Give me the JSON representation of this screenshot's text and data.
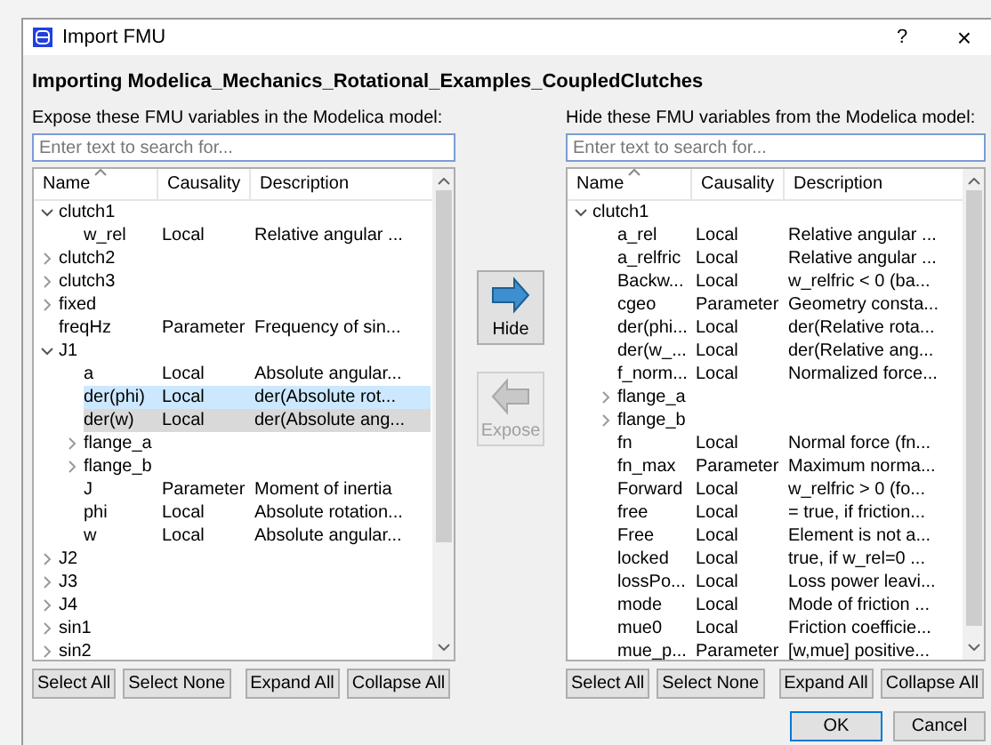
{
  "window": {
    "title": "Import FMU",
    "help": "?",
    "close": "×"
  },
  "heading": "Importing Modelica_Mechanics_Rotational_Examples_CoupledClutches",
  "panels": [
    {
      "label": "Expose these FMU variables in the Modelica model:",
      "search": {
        "placeholder": "Enter text to search for..."
      },
      "columns": [
        "Name",
        "Causality",
        "Description"
      ],
      "tree": [
        {
          "name": "clutch1",
          "expanded": true,
          "selected": false,
          "hovered": false,
          "children": [
            {
              "name": "w_rel",
              "causality": "Local",
              "description": "Relative angular ...",
              "selected": false,
              "hovered": false
            }
          ]
        },
        {
          "name": "clutch2",
          "expanded": false,
          "selected": false,
          "hovered": false
        },
        {
          "name": "clutch3",
          "expanded": false,
          "selected": false,
          "hovered": false
        },
        {
          "name": "fixed",
          "expanded": false,
          "selected": false,
          "hovered": false
        },
        {
          "name": "freqHz",
          "causality": "Parameter",
          "description": "Frequency of sin...",
          "selected": false,
          "hovered": false
        },
        {
          "name": "J1",
          "expanded": true,
          "selected": false,
          "hovered": false,
          "children": [
            {
              "name": "a",
              "causality": "Local",
              "description": "Absolute angular...",
              "selected": false,
              "hovered": false
            },
            {
              "name": "der(phi)",
              "causality": "Local",
              "description": "der(Absolute rot...",
              "selected": true,
              "hovered": false
            },
            {
              "name": "der(w)",
              "causality": "Local",
              "description": "der(Absolute ang...",
              "selected": false,
              "hovered": true
            },
            {
              "name": "flange_a",
              "expanded": false,
              "selected": false,
              "hovered": false
            },
            {
              "name": "flange_b",
              "expanded": false,
              "selected": false,
              "hovered": false
            },
            {
              "name": "J",
              "causality": "Parameter",
              "description": "Moment of inertia",
              "selected": false,
              "hovered": false
            },
            {
              "name": "phi",
              "causality": "Local",
              "description": "Absolute rotation...",
              "selected": false,
              "hovered": false
            },
            {
              "name": "w",
              "causality": "Local",
              "description": "Absolute angular...",
              "selected": false,
              "hovered": false
            }
          ]
        },
        {
          "name": "J2",
          "expanded": false,
          "selected": false,
          "hovered": false
        },
        {
          "name": "J3",
          "expanded": false,
          "selected": false,
          "hovered": false
        },
        {
          "name": "J4",
          "expanded": false,
          "selected": false,
          "hovered": false
        },
        {
          "name": "sin1",
          "expanded": false,
          "selected": false,
          "hovered": false
        },
        {
          "name": "sin2",
          "expanded": false,
          "selected": false,
          "hovered": false
        }
      ],
      "buttons": [
        "Select All",
        "Select None",
        "Expand All",
        "Collapse All"
      ]
    },
    {
      "label": "Hide these FMU variables from the Modelica model:",
      "search": {
        "placeholder": "Enter text to search for..."
      },
      "columns": [
        "Name",
        "Causality",
        "Description"
      ],
      "tree": [
        {
          "name": "clutch1",
          "expanded": true,
          "selected": false,
          "hovered": false,
          "children": [
            {
              "name": "a_rel",
              "causality": "Local",
              "description": "Relative angular ...",
              "selected": false,
              "hovered": false
            },
            {
              "name": "a_relfric",
              "causality": "Local",
              "description": "Relative angular ...",
              "selected": false,
              "hovered": false
            },
            {
              "name": "Backw...",
              "causality": "Local",
              "description": "w_relfric < 0 (ba...",
              "selected": false,
              "hovered": false
            },
            {
              "name": "cgeo",
              "causality": "Parameter",
              "description": "Geometry consta...",
              "selected": false,
              "hovered": false
            },
            {
              "name": "der(phi...",
              "causality": "Local",
              "description": "der(Relative rota...",
              "selected": false,
              "hovered": false
            },
            {
              "name": "der(w_...",
              "causality": "Local",
              "description": "der(Relative ang...",
              "selected": false,
              "hovered": false
            },
            {
              "name": "f_norm...",
              "causality": "Local",
              "description": "Normalized force...",
              "selected": false,
              "hovered": false
            },
            {
              "name": "flange_a",
              "expanded": false,
              "selected": false,
              "hovered": false
            },
            {
              "name": "flange_b",
              "expanded": false,
              "selected": false,
              "hovered": false
            },
            {
              "name": "fn",
              "causality": "Local",
              "description": "Normal force (fn...",
              "selected": false,
              "hovered": false
            },
            {
              "name": "fn_max",
              "causality": "Parameter",
              "description": "Maximum norma...",
              "selected": false,
              "hovered": false
            },
            {
              "name": "Forward",
              "causality": "Local",
              "description": "w_relfric > 0 (fo...",
              "selected": false,
              "hovered": false
            },
            {
              "name": "free",
              "causality": "Local",
              "description": "= true, if friction...",
              "selected": false,
              "hovered": false
            },
            {
              "name": "Free",
              "causality": "Local",
              "description": "Element is not a...",
              "selected": false,
              "hovered": false
            },
            {
              "name": "locked",
              "causality": "Local",
              "description": "true, if w_rel=0 ...",
              "selected": false,
              "hovered": false
            },
            {
              "name": "lossPo...",
              "causality": "Local",
              "description": "Loss power leavi...",
              "selected": false,
              "hovered": false
            },
            {
              "name": "mode",
              "causality": "Local",
              "description": "Mode of friction ...",
              "selected": false,
              "hovered": false
            },
            {
              "name": "mue0",
              "causality": "Local",
              "description": "Friction coefficie...",
              "selected": false,
              "hovered": false
            },
            {
              "name": "mue_p...",
              "causality": "Parameter",
              "description": "[w,mue] positive...",
              "selected": false,
              "hovered": false
            }
          ]
        }
      ],
      "buttons": [
        "Select All",
        "Select None",
        "Expand All",
        "Collapse All"
      ]
    }
  ],
  "transfer": [
    {
      "kind": "hide",
      "label": "Hide",
      "disabled": false
    },
    {
      "kind": "expose",
      "label": "Expose",
      "disabled": true
    }
  ],
  "dialog_buttons": [
    {
      "label": "OK",
      "default": true
    },
    {
      "label": "Cancel",
      "default": false
    }
  ]
}
